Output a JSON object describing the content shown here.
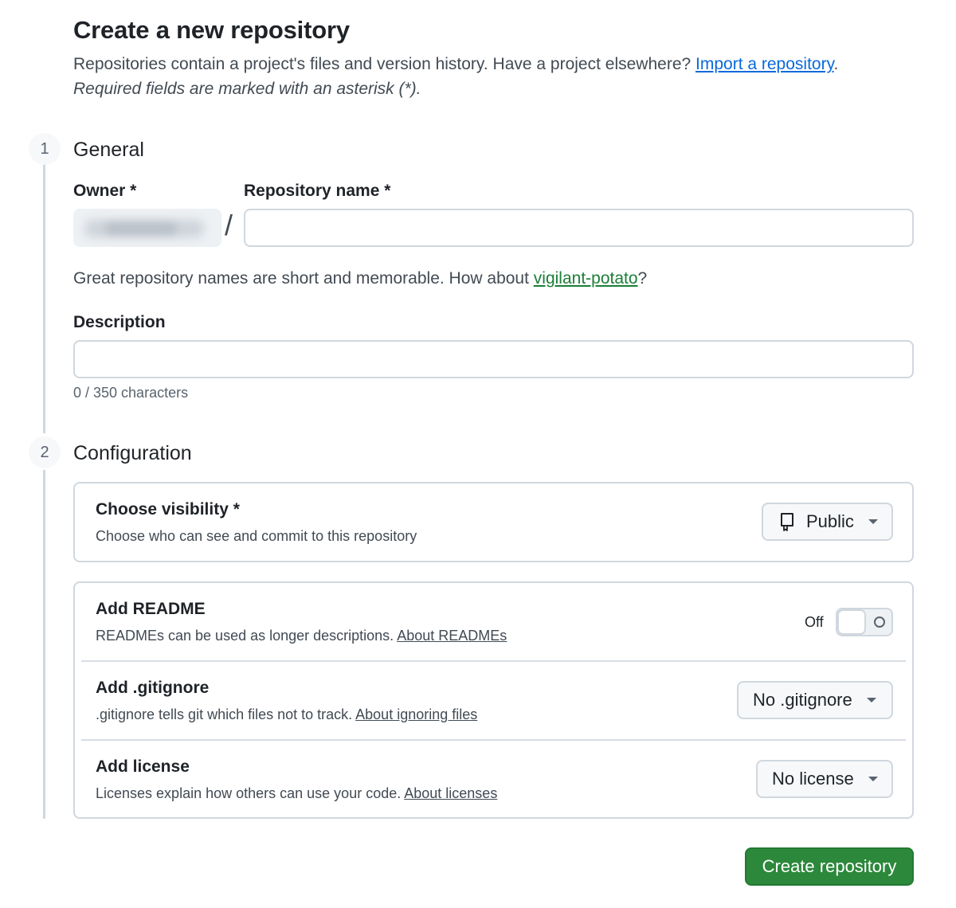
{
  "header": {
    "title": "Create a new repository",
    "intro_text": "Repositories contain a project's files and version history. Have a project elsewhere? ",
    "import_link": "Import a repository",
    "intro_end": ".",
    "required_note": "Required fields are marked with an asterisk (*)."
  },
  "steps": [
    {
      "number": "1",
      "title": "General"
    },
    {
      "number": "2",
      "title": "Configuration"
    }
  ],
  "general": {
    "owner_label": "Owner *",
    "slash": "/",
    "repo_name_label": "Repository name *",
    "repo_name_value": "",
    "hint_text": "Great repository names are short and memorable. How about ",
    "suggestion": "vigilant-potato",
    "hint_end": "?",
    "description_label": "Description",
    "description_value": "",
    "char_counter": "0 / 350 characters"
  },
  "configuration": {
    "visibility": {
      "title": "Choose visibility *",
      "description": "Choose who can see and commit to this repository",
      "button_label": "Public",
      "button_icon": "repo-icon"
    },
    "readme": {
      "title": "Add README",
      "description": "READMEs can be used as longer descriptions. ",
      "link": "About READMEs",
      "toggle_state": "Off"
    },
    "gitignore": {
      "title": "Add .gitignore",
      "description": ".gitignore tells git which files not to track. ",
      "link": "About ignoring files",
      "button_label": "No .gitignore"
    },
    "license": {
      "title": "Add license",
      "description": "Licenses explain how others can use your code. ",
      "link": "About licenses",
      "button_label": "No license"
    }
  },
  "actions": {
    "create_label": "Create repository"
  },
  "colors": {
    "primary_button": "#2c883b",
    "link": "#0969da",
    "suggestion": "#1a7f37",
    "border": "#d0d7de"
  }
}
